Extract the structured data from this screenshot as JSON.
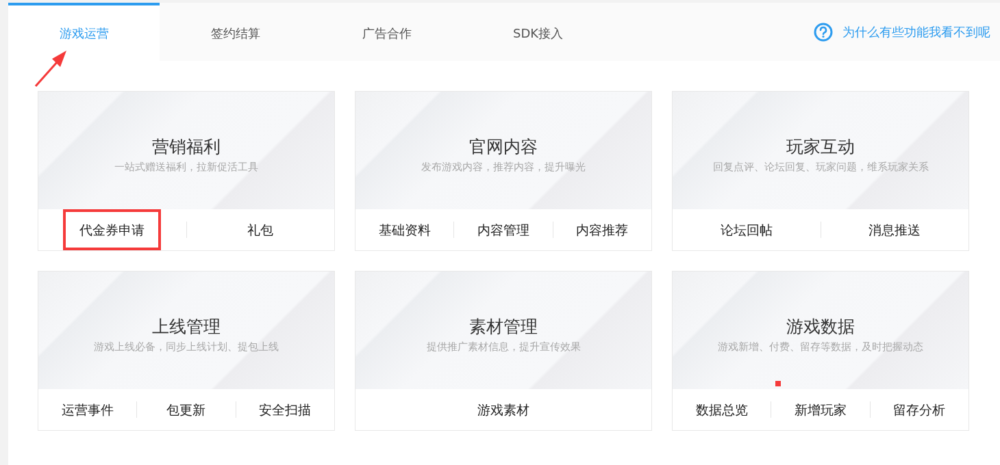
{
  "tabs": [
    {
      "label": "游戏运营",
      "selected": true
    },
    {
      "label": "签约结算",
      "selected": false
    },
    {
      "label": "广告合作",
      "selected": false
    },
    {
      "label": "SDK接入",
      "selected": false
    }
  ],
  "help_link": {
    "label": "为什么有些功能我看不到呢"
  },
  "arrow_annotation": true,
  "cards": [
    {
      "title": "营销福利",
      "subtitle": "一站式赠送福利，拉新促活工具",
      "marker_dot": false,
      "links": [
        {
          "label": "代金券申请",
          "highlighted": true
        },
        {
          "label": "礼包",
          "highlighted": false
        }
      ]
    },
    {
      "title": "官网内容",
      "subtitle": "发布游戏内容，推荐内容，提升曝光",
      "marker_dot": false,
      "links": [
        {
          "label": "基础资料",
          "highlighted": false
        },
        {
          "label": "内容管理",
          "highlighted": false
        },
        {
          "label": "内容推荐",
          "highlighted": false
        }
      ]
    },
    {
      "title": "玩家互动",
      "subtitle": "回复点评、论坛回复、玩家问题，维系玩家关系",
      "marker_dot": false,
      "links": [
        {
          "label": "论坛回帖",
          "highlighted": false
        },
        {
          "label": "消息推送",
          "highlighted": false
        }
      ]
    },
    {
      "title": "上线管理",
      "subtitle": "游戏上线必备，同步上线计划、提包上线",
      "marker_dot": false,
      "links": [
        {
          "label": "运营事件",
          "highlighted": false
        },
        {
          "label": "包更新",
          "highlighted": false
        },
        {
          "label": "安全扫描",
          "highlighted": false
        }
      ]
    },
    {
      "title": "素材管理",
      "subtitle": "提供推广素材信息，提升宣传效果",
      "marker_dot": false,
      "links": [
        {
          "label": "游戏素材",
          "highlighted": false
        }
      ]
    },
    {
      "title": "游戏数据",
      "subtitle": "游戏新增、付费、留存等数据，及时把握动态",
      "marker_dot": true,
      "links": [
        {
          "label": "数据总览",
          "highlighted": false
        },
        {
          "label": "新增玩家",
          "highlighted": false
        },
        {
          "label": "留存分析",
          "highlighted": false
        }
      ]
    }
  ]
}
